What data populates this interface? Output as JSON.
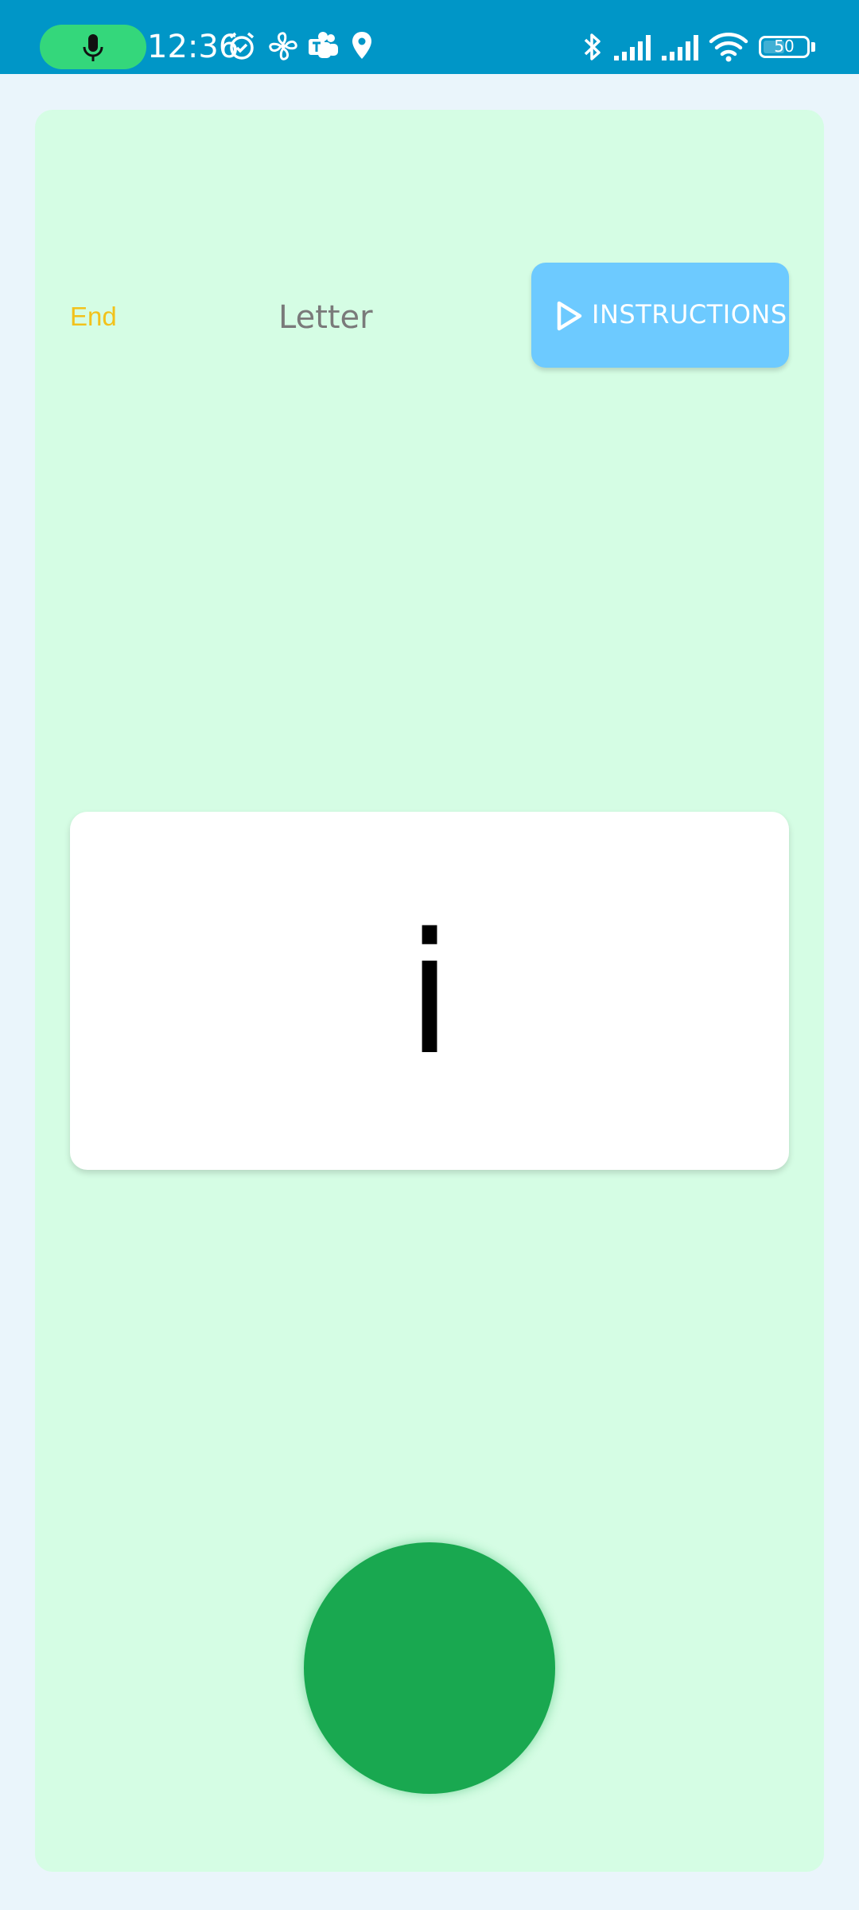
{
  "status_bar": {
    "time": "12:36",
    "battery": "50",
    "battery_fraction": 0.5,
    "icons": [
      "mic-icon",
      "alarm-icon",
      "fan-icon",
      "teams-icon",
      "location-icon",
      "bluetooth-icon",
      "signal-icon",
      "signal-icon",
      "wifi-icon",
      "battery-icon"
    ]
  },
  "header": {
    "end_label": "End",
    "title": "Letter",
    "instructions_label": "INSTRUCTIONS"
  },
  "card": {
    "letter": "i"
  },
  "colors": {
    "status_bar": "#0096c7",
    "background": "#eaf5fb",
    "card": "#d5fde4",
    "end_text": "#f2c21b",
    "instructions_button": "#6dcaff",
    "record_button": "#19a850",
    "mic_pill": "#34d77b"
  }
}
